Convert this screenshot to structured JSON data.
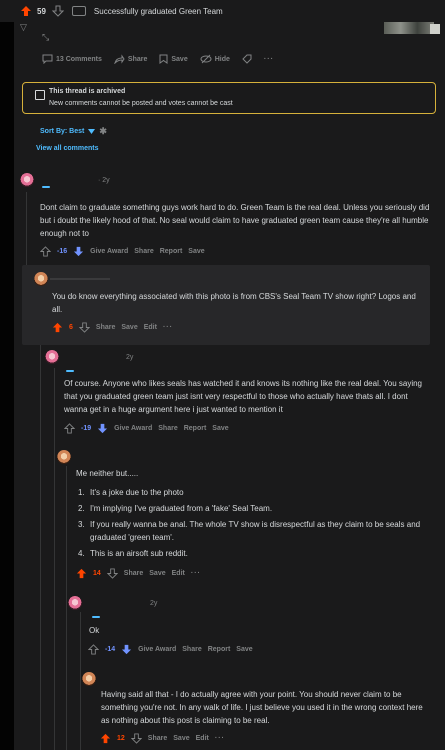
{
  "header": {
    "score": "59",
    "title": "Successfully graduated Green Team"
  },
  "post_actions": {
    "comments": "13 Comments",
    "share": "Share",
    "save": "Save",
    "hide": "Hide"
  },
  "archived": {
    "title": "This thread is archived",
    "message": "New comments cannot be posted and votes cannot be cast"
  },
  "sort": {
    "label": "Sort By: Best"
  },
  "view_all": "View all comments",
  "comments": [
    {
      "time": "· 2y",
      "body": "Dont claim to graduate something guys work hard to do. Green Team is the real deal. Unless you seriously did but i doubt the likely hood of that. No seal would claim to have graduated green team cause they're all humble enough not to",
      "score": "-16",
      "actions": [
        "Give Award",
        "Share",
        "Report",
        "Save"
      ]
    },
    {
      "body": "You do know everything associated with this photo is from CBS's Seal Team TV show right? Logos and all.",
      "score": "6",
      "actions": [
        "Share",
        "Save",
        "Edit"
      ]
    },
    {
      "time": "2y",
      "body": "Of course. Anyone who likes seals has watched it and knows its nothing like the real deal. You saying that you graduated green team just isnt very respectful to those who actually have thats all. I dont wanna get in a huge argument here i just wanted to mention it",
      "score": "-19",
      "actions": [
        "Give Award",
        "Share",
        "Report",
        "Save"
      ]
    },
    {
      "intro": "Me neither but.....",
      "list": [
        {
          "n": "1.",
          "text": "It's a joke due to the photo"
        },
        {
          "n": "2.",
          "text": "I'm implying I've graduated from a 'fake' Seal Team."
        },
        {
          "n": "3.",
          "text": "If you really wanna be anal. The whole TV show is disrespectful as they claim to be seals and graduated 'green team'."
        },
        {
          "n": "4.",
          "text": "This is an airsoft sub reddit."
        }
      ],
      "score": "14",
      "actions": [
        "Share",
        "Save",
        "Edit"
      ]
    },
    {
      "time": "2y",
      "body": "Ok",
      "score": "-14",
      "actions": [
        "Give Award",
        "Share",
        "Report",
        "Save"
      ]
    },
    {
      "body": "Having said all that - I do actually agree with your point. You should never claim to be something you're not. In any walk of life. I just believe you used it in the wrong context here as nothing about this post is claiming to be real.",
      "score": "12",
      "actions": [
        "Share",
        "Save",
        "Edit"
      ]
    }
  ],
  "colors": {
    "accent": "#4fbcff",
    "upvote": "#ff4500",
    "downvote": "#7193ff",
    "archived_border": "#d6b13b"
  }
}
